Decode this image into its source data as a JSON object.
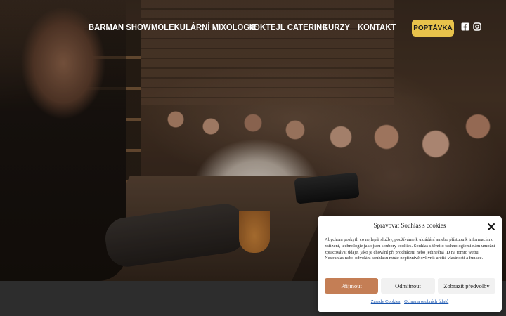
{
  "nav": {
    "items": [
      {
        "label": "BARMAN SHOW"
      },
      {
        "label": "MOLEKULÁRNÍ MIXOLOGIE"
      },
      {
        "label": "KOKTEJL CATERING"
      },
      {
        "label": "KURZY"
      },
      {
        "label": "KONTAKT"
      }
    ],
    "cta_label": "POPTÁVKA",
    "social_icons": [
      "facebook-icon",
      "instagram-icon"
    ]
  },
  "colors": {
    "cta": "#e8c24b",
    "accept_button": "#c47e55",
    "link": "#1a56b0",
    "bottom_band": "#2d2d2d"
  },
  "cookie": {
    "title": "Spravovat Souhlas s cookies",
    "text": "Abychom poskytli co nejlepší služby, používáme k ukládání a/nebo přístupu k informacím o zařízení, technologie jako jsou soubory cookies. Souhlas s těmito technologiemi nám umožní zpracovávat údaje, jako je chování při procházení nebo jedinečná ID na tomto webu. Nesouhlas nebo odvolání souhlasu může nepříznivě ovlivnit určité vlastnosti a funkce.",
    "accept_label": "Přijmout",
    "deny_label": "Odmítnout",
    "prefs_label": "Zobrazit předvolby",
    "links": [
      {
        "label": "Zásady Cookies"
      },
      {
        "label": "Ochrana osobních údajů"
      }
    ]
  }
}
